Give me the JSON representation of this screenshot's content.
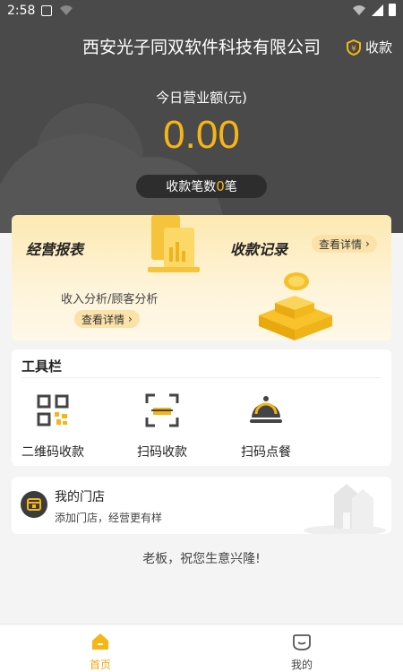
{
  "status_bar": {
    "time": "2:58"
  },
  "header": {
    "company": "西安光子同双软件科技有限公司",
    "collect_label": "收款",
    "today_label": "今日营业额(元)",
    "amount": "0.00",
    "count_prefix": "收款笔数",
    "count_value": "0",
    "count_suffix": "笔"
  },
  "report_card": {
    "title_report": "经营报表",
    "title_records": "收款记录",
    "records_detail": "查看详情",
    "subtitle": "收入分析/顾客分析",
    "report_detail": "查看详情"
  },
  "toolbar": {
    "title": "工具栏",
    "tools": [
      {
        "label": "二维码收款",
        "icon": "qr-code-icon"
      },
      {
        "label": "扫码收款",
        "icon": "scan-icon"
      },
      {
        "label": "扫码点餐",
        "icon": "food-cloche-icon"
      }
    ]
  },
  "store": {
    "title": "我的门店",
    "subtitle": "添加门店，经营更有样"
  },
  "greeting": "老板，祝您生意兴隆!",
  "bottom_nav": {
    "items": [
      {
        "label": "首页",
        "icon": "home-icon"
      },
      {
        "label": "我的",
        "icon": "profile-icon"
      }
    ]
  },
  "colors": {
    "accent": "#f7b515",
    "header_bg": "#4a4a4a",
    "card_yellow": "#fde9b1"
  }
}
